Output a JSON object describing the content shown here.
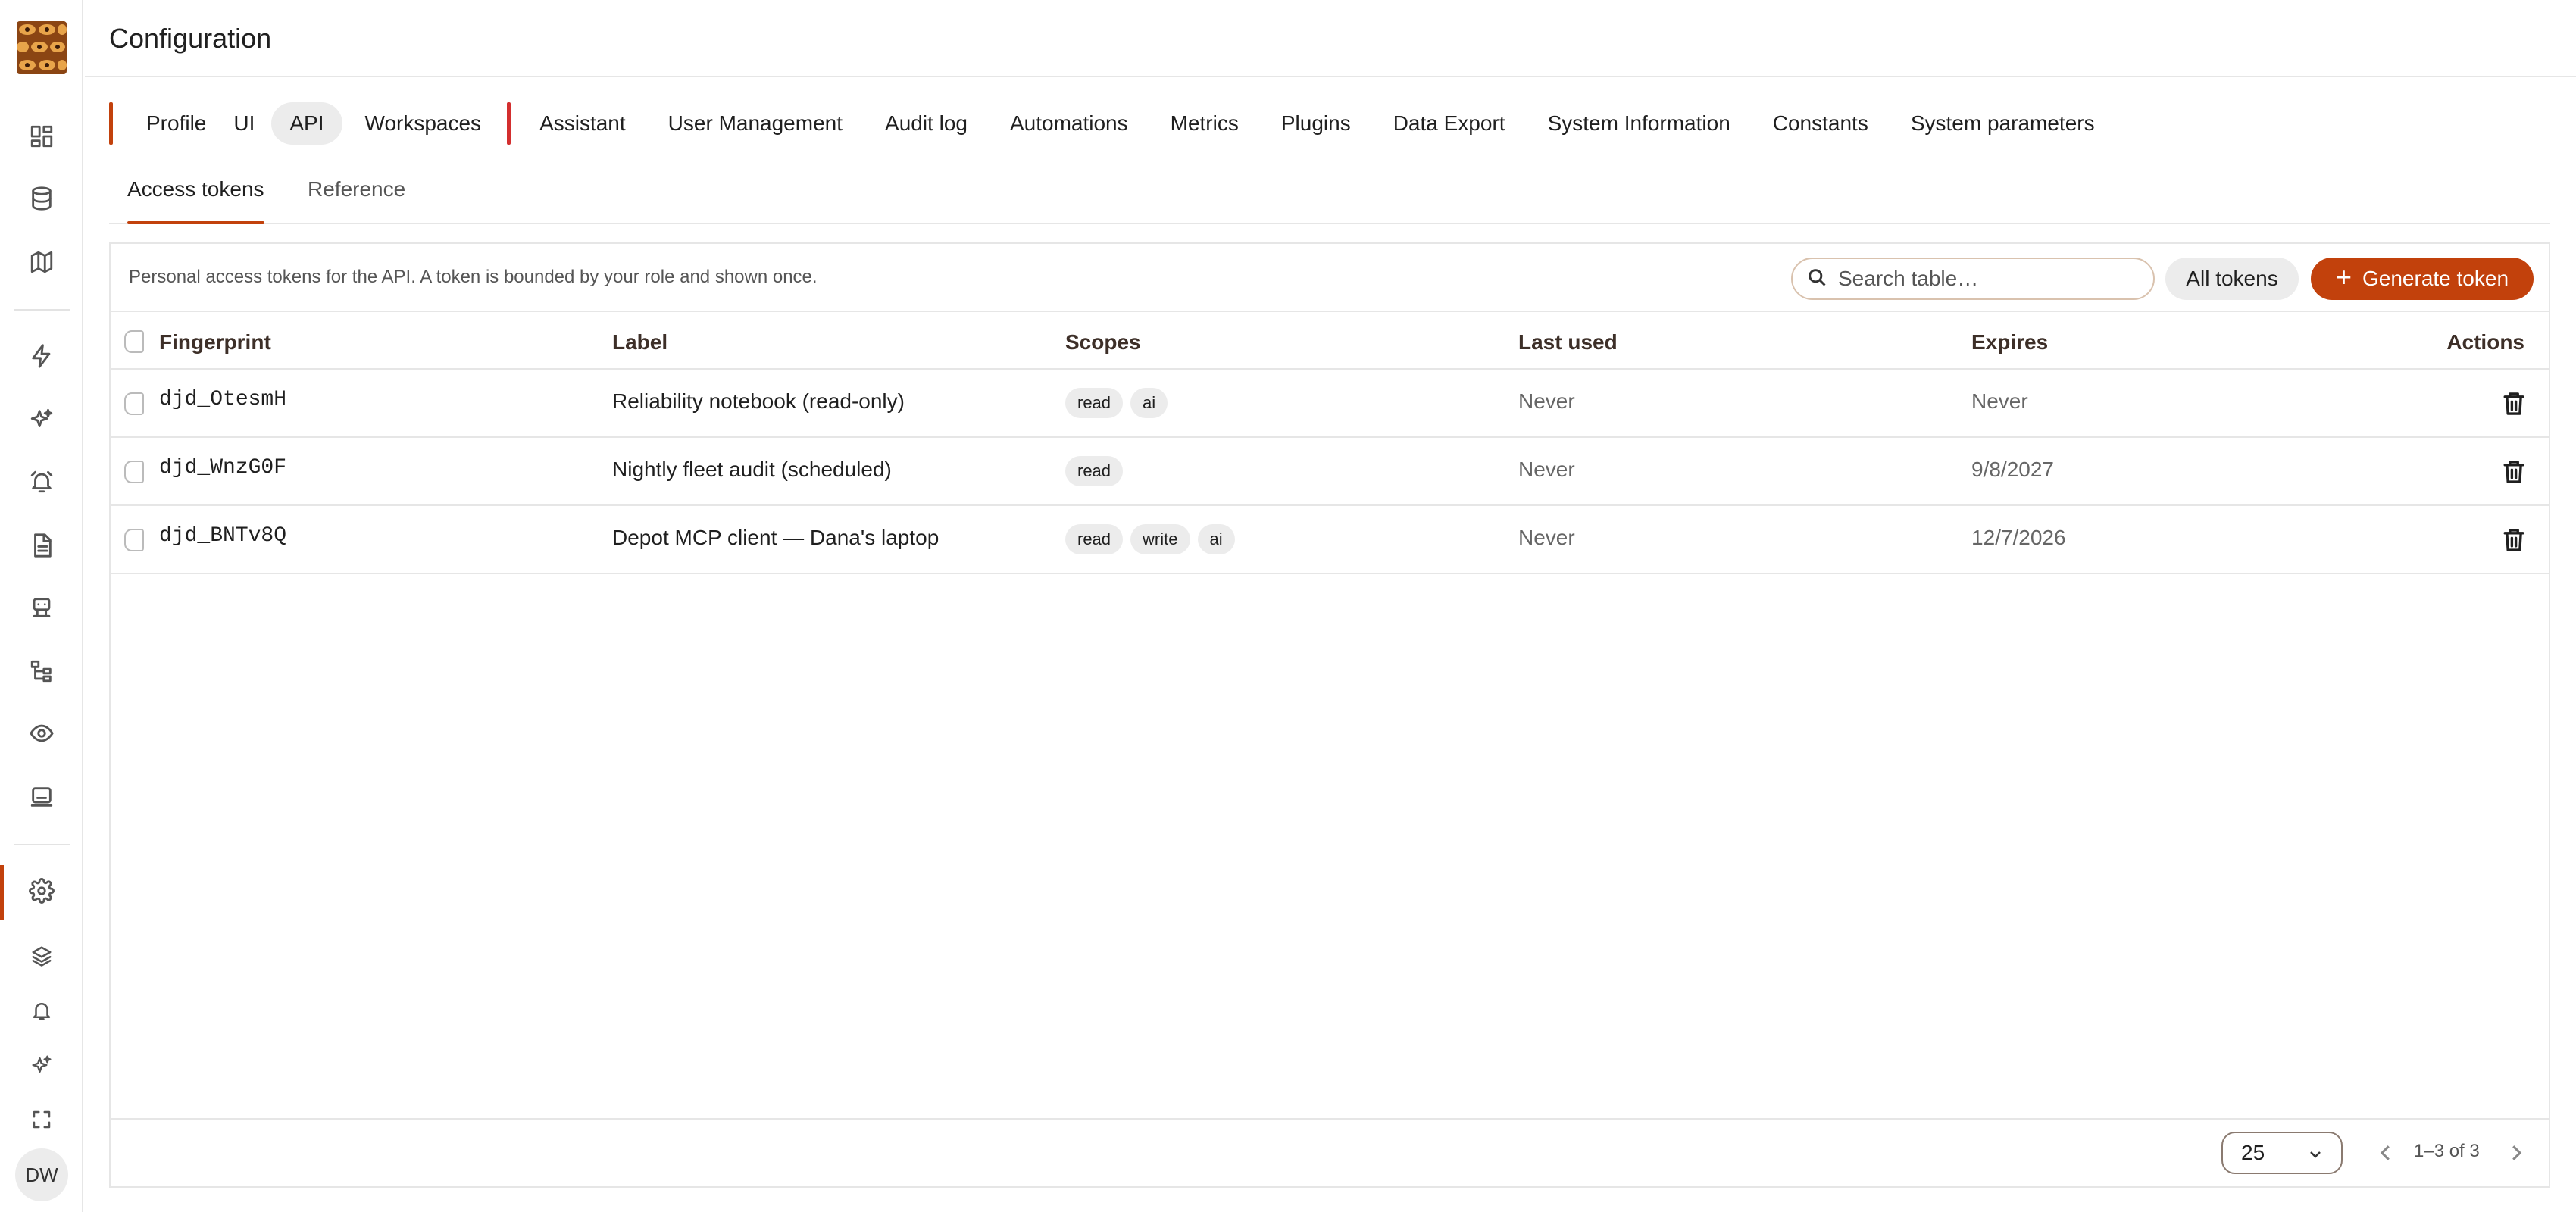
{
  "header": {
    "title": "Configuration"
  },
  "user": {
    "initials": "DW"
  },
  "top_tabs": [
    "Profile",
    "UI",
    "API",
    "Workspaces",
    "Assistant",
    "User Management",
    "Audit log",
    "Automations",
    "Metrics",
    "Plugins",
    "Data Export",
    "System Information",
    "Constants",
    "System parameters"
  ],
  "active_top_tab": "API",
  "sub_tabs": [
    "Access tokens",
    "Reference"
  ],
  "active_sub_tab": "Access tokens",
  "card": {
    "description": "Personal access tokens for the API. A token is bounded by your role and shown once.",
    "search_placeholder": "Search table…",
    "all_tokens_label": "All tokens",
    "generate_label": "Generate token"
  },
  "table": {
    "columns": [
      "Fingerprint",
      "Label",
      "Scopes",
      "Last used",
      "Expires",
      "Actions"
    ],
    "rows": [
      {
        "fingerprint": "djd_OtesmH",
        "label": "Reliability notebook (read-only)",
        "scopes": [
          "read",
          "ai"
        ],
        "last_used": "Never",
        "expires": "Never"
      },
      {
        "fingerprint": "djd_WnzG0F",
        "label": "Nightly fleet audit (scheduled)",
        "scopes": [
          "read"
        ],
        "last_used": "Never",
        "expires": "9/8/2027"
      },
      {
        "fingerprint": "djd_BNTv8Q",
        "label": "Depot MCP client — Dana's laptop",
        "scopes": [
          "read",
          "write",
          "ai"
        ],
        "last_used": "Never",
        "expires": "12/7/2026"
      }
    ]
  },
  "pagination": {
    "page_size": "25",
    "range": "1–3 of 3"
  },
  "colors": {
    "accent": "#c2410c",
    "tab_divider": "#d32f2f"
  },
  "sidebar_icons": [
    "dashboard-icon",
    "database-icon",
    "map-icon",
    "lightning-icon",
    "sparkles-icon",
    "alarm-icon",
    "document-icon",
    "robot-icon",
    "hierarchy-icon",
    "eye-icon",
    "monitor-icon",
    "settings-icon",
    "layers-icon",
    "bell-icon",
    "ai-sparkle-icon",
    "fullscreen-icon"
  ]
}
